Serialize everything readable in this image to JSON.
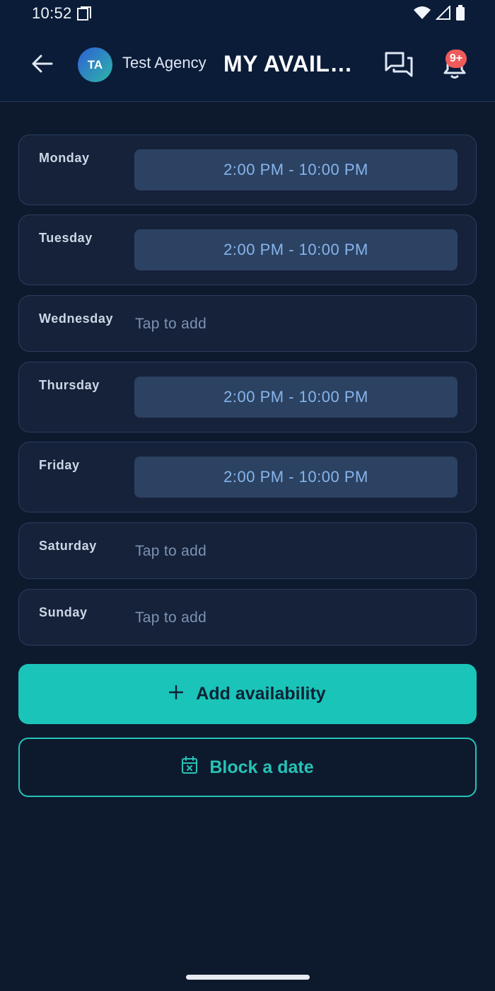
{
  "status": {
    "time": "10:52"
  },
  "header": {
    "avatar_initials": "TA",
    "agency": "Test Agency",
    "title": "MY AVAILABILITY",
    "badge": "9+"
  },
  "days": [
    {
      "label": "Monday",
      "slot": "2:00 PM - 10:00 PM"
    },
    {
      "label": "Tuesday",
      "slot": "2:00 PM - 10:00 PM"
    },
    {
      "label": "Wednesday",
      "placeholder": "Tap to add"
    },
    {
      "label": "Thursday",
      "slot": "2:00 PM - 10:00 PM"
    },
    {
      "label": "Friday",
      "slot": "2:00 PM - 10:00 PM"
    },
    {
      "label": "Saturday",
      "placeholder": "Tap to add"
    },
    {
      "label": "Sunday",
      "placeholder": "Tap to add"
    }
  ],
  "actions": {
    "add_label": "Add availability",
    "block_label": "Block a date"
  },
  "icons": {
    "back": "arrow-left-icon",
    "chat": "chat-icon",
    "bell": "bell-icon",
    "plus": "plus-icon",
    "calendar": "calendar-x-icon"
  },
  "colors": {
    "accent": "#1bc4b8",
    "badge": "#ef5b5b",
    "slot_text": "#86b4ec"
  }
}
